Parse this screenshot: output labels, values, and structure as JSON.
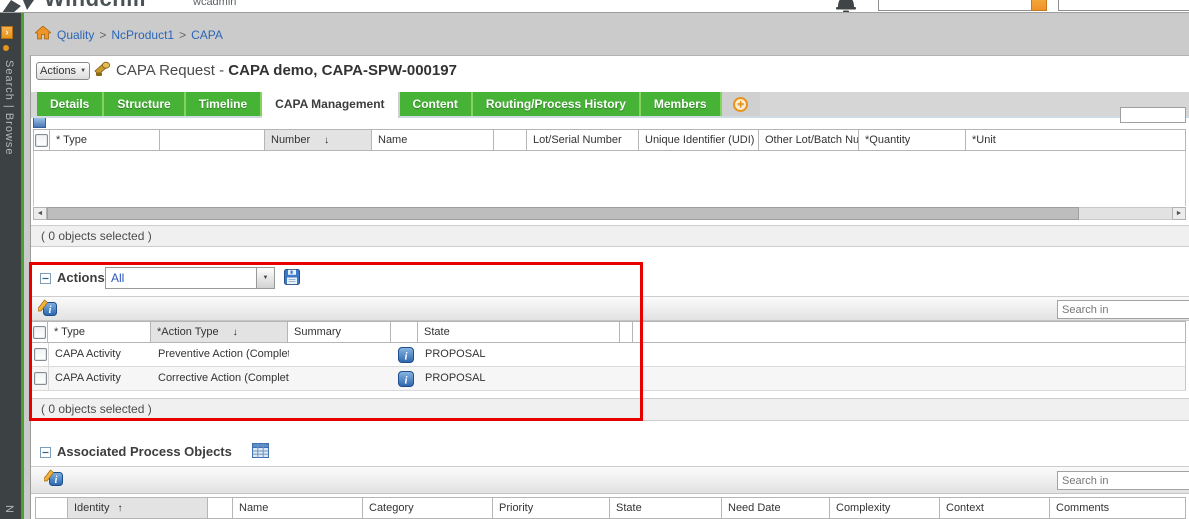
{
  "glyphs": {
    "caret_down": "▼",
    "sort_down": "↓",
    "sort_up": "↑",
    "scroll_left": "◄",
    "scroll_right": "►",
    "add": "+",
    "expand": "›",
    "breadcrumb_sep": ">"
  },
  "colors": {
    "tab_green": "#46b236",
    "accent_orange": "#e8931c",
    "link_blue": "#2a66b8",
    "highlight_red": "#e60000",
    "info_blue": "#2b66ad"
  },
  "topbar": {
    "app_name": "Windchill",
    "user_name": "wcadmin"
  },
  "sidebar": {
    "nav_label": "Search | Browse",
    "partial_bottom_label": "N"
  },
  "breadcrumb": {
    "items": [
      "Quality",
      "NcProduct1",
      "CAPA"
    ]
  },
  "page": {
    "actions_button_label": "Actions",
    "title_prefix": "CAPA Request - ",
    "title_name": "CAPA demo, CAPA-SPW-000197"
  },
  "tabs": {
    "items": [
      "Details",
      "Structure",
      "Timeline",
      "CAPA Management",
      "Content",
      "Routing/Process History",
      "Members"
    ],
    "active": "CAPA Management"
  },
  "items_table": {
    "columns": [
      "",
      "* Type",
      "",
      "Number",
      "Name",
      "",
      "Lot/Serial Number",
      "Unique Identifier (UDI)",
      "Other Lot/Batch Num...",
      "*Quantity",
      "*Unit"
    ],
    "sorted_column": "Number",
    "sort_direction": "descending",
    "status": "( 0 objects selected )"
  },
  "actions_section": {
    "title": "Actions",
    "filter_value": "All",
    "search_placeholder": "Search in",
    "table": {
      "columns": [
        "",
        "* Type",
        "*Action Type",
        "Summary",
        "",
        "State",
        "",
        ""
      ],
      "sorted_column": "*Action Type",
      "sort_direction": "descending",
      "rows": [
        {
          "type": "CAPA Activity",
          "action_type": "Preventive Action (Completed)",
          "summary": "",
          "state": "PROPOSAL"
        },
        {
          "type": "CAPA Activity",
          "action_type": "Corrective Action (Completed)",
          "summary": "",
          "state": "PROPOSAL"
        }
      ]
    },
    "status": "( 0 objects selected )"
  },
  "process_section": {
    "title": "Associated Process Objects",
    "search_placeholder": "Search in",
    "table": {
      "columns": [
        "",
        "Identity",
        "",
        "Name",
        "Category",
        "Priority",
        "State",
        "Need Date",
        "Complexity",
        "Context",
        "Comments"
      ],
      "sorted_column": "Identity",
      "sort_direction": "ascending"
    }
  }
}
